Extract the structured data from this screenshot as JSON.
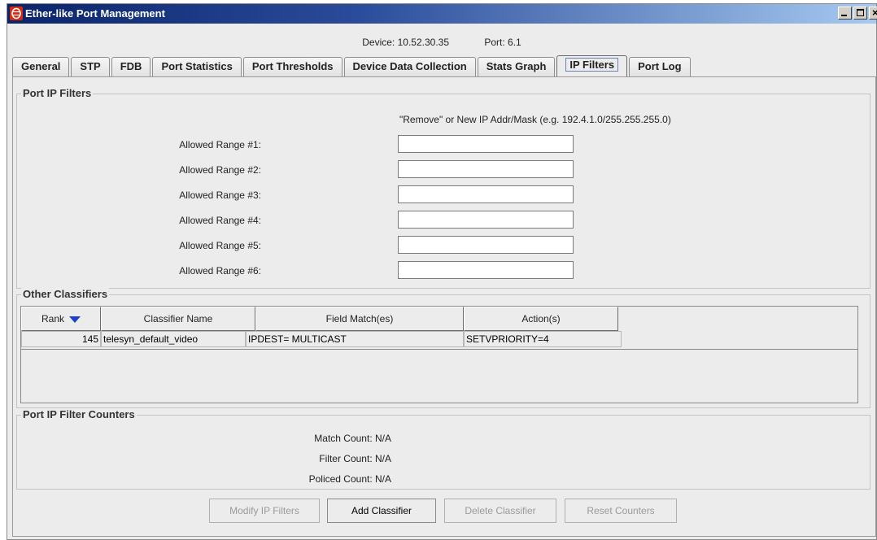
{
  "window": {
    "title": "Ether-like Port Management"
  },
  "device_info": {
    "device_label": "Device:",
    "device_value": "10.52.30.35",
    "port_label": "Port:",
    "port_value": "6.1"
  },
  "tabs": [
    {
      "label": "General"
    },
    {
      "label": "STP"
    },
    {
      "label": "FDB"
    },
    {
      "label": "Port Statistics"
    },
    {
      "label": "Port Thresholds"
    },
    {
      "label": "Device Data Collection"
    },
    {
      "label": "Stats Graph"
    },
    {
      "label": "IP Filters",
      "active": true
    },
    {
      "label": "Port Log"
    }
  ],
  "ip_filters": {
    "title": "Port IP Filters",
    "hint": "\"Remove\" or New IP Addr/Mask (e.g. 192.4.1.0/255.255.255.0)",
    "ranges": [
      {
        "label": "Allowed Range #1:",
        "value": ""
      },
      {
        "label": "Allowed Range #2:",
        "value": ""
      },
      {
        "label": "Allowed Range #3:",
        "value": ""
      },
      {
        "label": "Allowed Range #4:",
        "value": ""
      },
      {
        "label": "Allowed Range #5:",
        "value": ""
      },
      {
        "label": "Allowed Range #6:",
        "value": ""
      }
    ]
  },
  "classifiers": {
    "title": "Other Classifiers",
    "columns": [
      "Rank",
      "Classifier Name",
      "Field Match(es)",
      "Action(s)"
    ],
    "sort_column": "Rank",
    "rows": [
      {
        "rank": "145",
        "name": "telesyn_default_video",
        "match": "IPDEST= MULTICAST",
        "action": "SETVPRIORITY=4"
      }
    ]
  },
  "counters": {
    "title": "Port IP Filter Counters",
    "items": [
      {
        "label": "Match Count:",
        "value": "N/A"
      },
      {
        "label": "Filter Count:",
        "value": "N/A"
      },
      {
        "label": "Policed Count:",
        "value": "N/A"
      }
    ]
  },
  "buttons": {
    "modify": {
      "label": "Modify IP Filters",
      "enabled": false
    },
    "add": {
      "label": "Add Classifier",
      "enabled": true
    },
    "delete": {
      "label": "Delete Classifier",
      "enabled": false
    },
    "reset": {
      "label": "Reset Counters",
      "enabled": false
    }
  },
  "colors": {
    "title_bar_start": "#0a246a",
    "title_bar_end": "#a6caf0",
    "sort_arrow": "#1e40c8",
    "window_bg": "#ececec"
  }
}
